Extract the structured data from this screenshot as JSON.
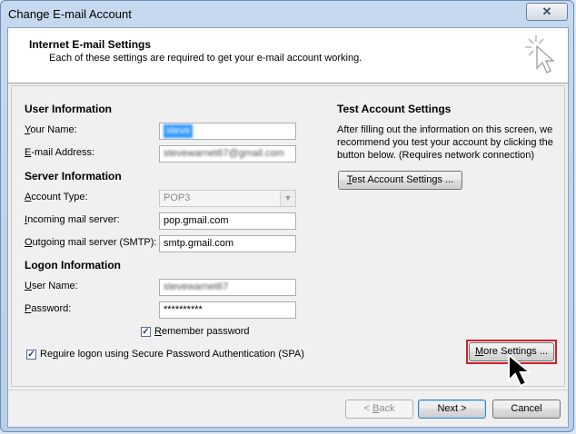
{
  "window": {
    "title": "Change E-mail Account",
    "close_glyph": "✕"
  },
  "header": {
    "title": "Internet E-mail Settings",
    "subtitle": "Each of these settings are required to get your e-mail account working."
  },
  "user_info": {
    "heading": "User Information",
    "name_label_pre": "",
    "name_label_u": "Y",
    "name_label_post": "our Name:",
    "name_value": "steve",
    "email_label_u": "E",
    "email_label_post": "-mail Address:",
    "email_value": "stevewarnet67@gmail.com"
  },
  "server_info": {
    "heading": "Server Information",
    "account_type_label_u": "A",
    "account_type_label_post": "ccount Type:",
    "account_type_value": "POP3",
    "incoming_label_u": "I",
    "incoming_label_post": "ncoming mail server:",
    "incoming_value": "pop.gmail.com",
    "outgoing_label_u": "O",
    "outgoing_label_post": "utgoing mail server (SMTP):",
    "outgoing_value": "smtp.gmail.com"
  },
  "logon_info": {
    "heading": "Logon Information",
    "username_label_u": "U",
    "username_label_post": "ser Name:",
    "username_value": "stevewarnet67",
    "password_label_u": "P",
    "password_label_post": "assword:",
    "password_value": "**********",
    "remember_label_u": "R",
    "remember_label_post": "emember password",
    "remember_checked": true,
    "spa_label_pre": "Re",
    "spa_label_u": "q",
    "spa_label_post": "uire logon using Secure Password Authentication (SPA)",
    "spa_checked": true
  },
  "test_settings": {
    "heading": "Test Account Settings",
    "desc_line1": "After filling out the information on this screen, we",
    "desc_line2": "recommend you test your account by clicking the",
    "desc_line3": "button below. (Requires network connection)",
    "button_u": "T",
    "button_post": "est Account Settings ..."
  },
  "more_settings": {
    "label_pre": "",
    "label_u": "M",
    "label_post": "ore Settings ..."
  },
  "footer": {
    "back_pre": "< ",
    "back_u": "B",
    "back_post": "ack",
    "next_label": "Next >",
    "cancel_label": "Cancel"
  },
  "colors": {
    "highlight": "#d2202a",
    "title_bar": "#c6d9ef",
    "selection": "#3399ff"
  }
}
